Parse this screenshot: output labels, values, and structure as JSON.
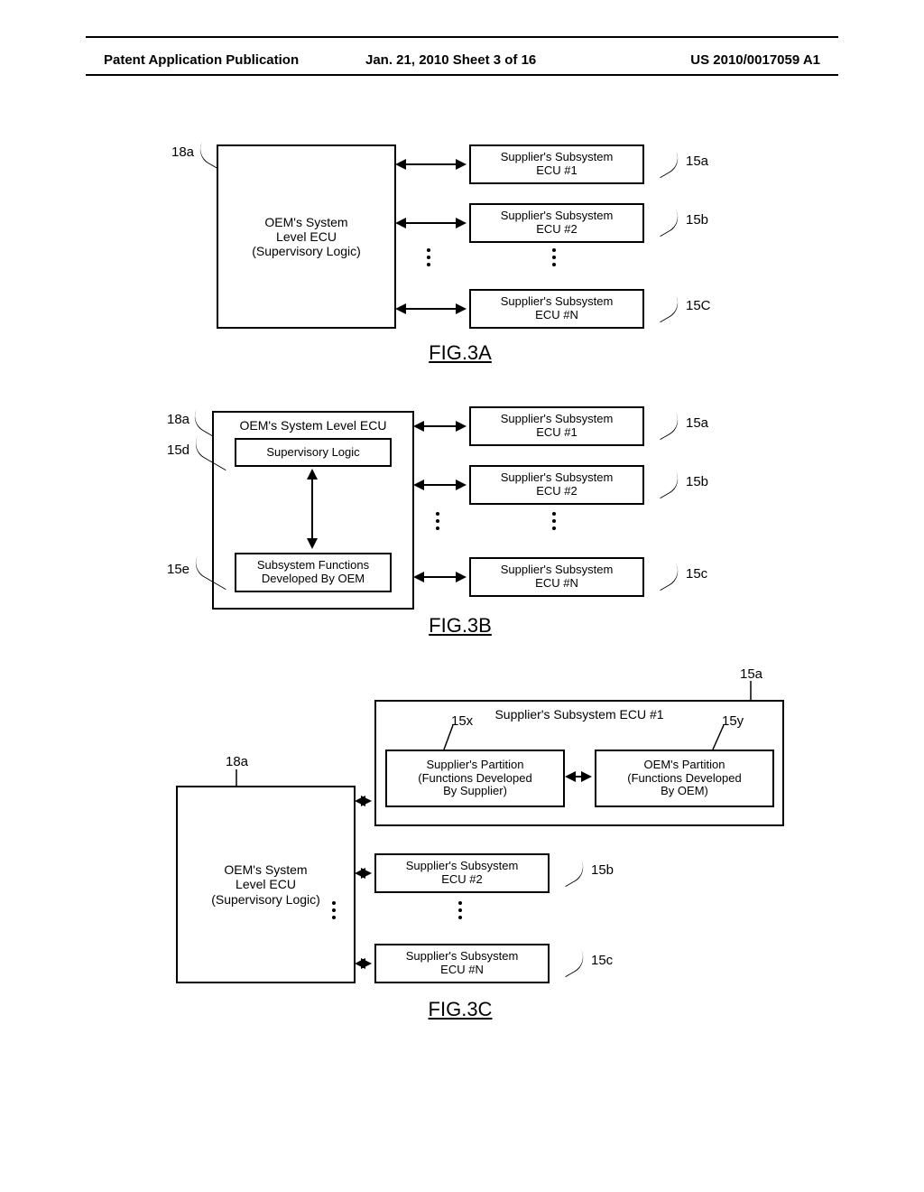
{
  "header": {
    "left": "Patent Application Publication",
    "center": "Jan. 21, 2010  Sheet 3 of 16",
    "right": "US 2010/0017059 A1"
  },
  "figA": {
    "title": "FIG.3A",
    "oem": "OEM's System\nLevel ECU\n(Supervisory Logic)",
    "sub1": "Supplier's Subsystem\nECU #1",
    "sub2": "Supplier's Subsystem\nECU #2",
    "subN": "Supplier's Subsystem\nECU #N",
    "ref_oem": "18a",
    "ref1": "15a",
    "ref2": "15b",
    "refN": "15C"
  },
  "figB": {
    "title": "FIG.3B",
    "oem_top": "OEM's System Level ECU",
    "oem_mid": "Supervisory Logic",
    "oem_bot": "Subsystem Functions\nDeveloped By OEM",
    "sub1": "Supplier's Subsystem\nECU #1",
    "sub2": "Supplier's Subsystem\nECU #2",
    "subN": "Supplier's Subsystem\nECU #N",
    "ref_oem": "18a",
    "ref_d": "15d",
    "ref_e": "15e",
    "ref1": "15a",
    "ref2": "15b",
    "refN": "15c"
  },
  "figC": {
    "title": "FIG.3C",
    "oem": "OEM's System\nLevel ECU\n(Supervisory Logic)",
    "sub1_title": "Supplier's Subsystem ECU #1",
    "part_left": "Supplier's Partition\n(Functions Developed\nBy Supplier)",
    "part_right": "OEM's Partition\n(Functions Developed\nBy OEM)",
    "sub2": "Supplier's Subsystem\nECU #2",
    "subN": "Supplier's Subsystem\nECU #N",
    "ref_oem": "18a",
    "ref1": "15a",
    "ref_x": "15x",
    "ref_y": "15y",
    "ref2": "15b",
    "refN": "15c"
  }
}
